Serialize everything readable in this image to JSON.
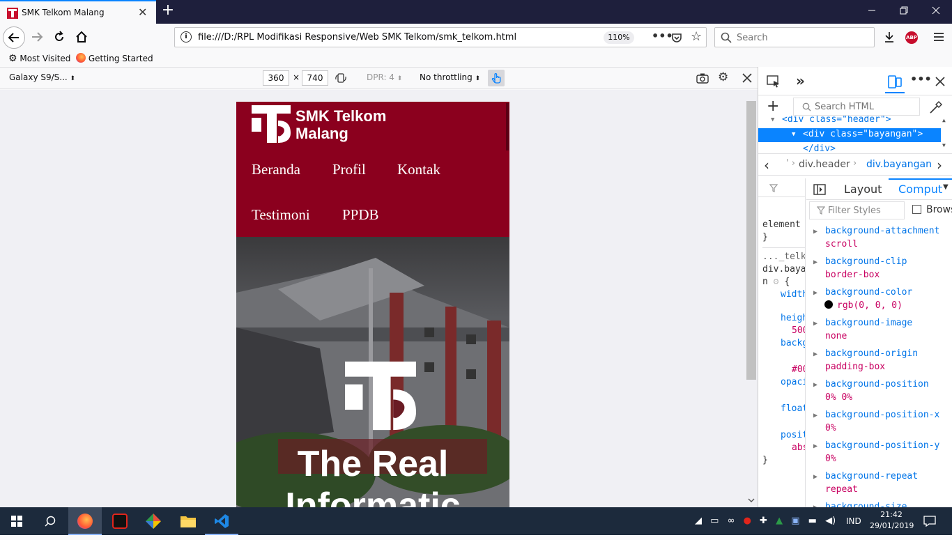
{
  "browser": {
    "tab_title": "SMK Telkom Malang",
    "tab_close": "✕",
    "new_tab": "+",
    "url": "file:///D:/RPL Modifikasi Responsive/Web SMK Telkom/smk_telkom.html",
    "zoom": "110%",
    "search_placeholder": "Search",
    "abp": "ABP",
    "accent": "#0a84ff"
  },
  "bookmarks": {
    "most_visited": "Most Visited",
    "getting_started": "Getting Started"
  },
  "rdm": {
    "device": "Galaxy S9/S...",
    "width": "360",
    "times": "×",
    "height": "740",
    "dpr": "DPR: 4",
    "throttling": "No throttling"
  },
  "site": {
    "brand_line1": "SMK Telkom",
    "brand_line2": "Malang",
    "menu": [
      "Beranda",
      "Profil",
      "Kontak",
      "Testimoni",
      "PPDB"
    ],
    "hero_title_line1": "The Real",
    "hero_title_line2": "Informatic",
    "header_color": "#8b001e"
  },
  "devtools": {
    "search_html": "Search HTML",
    "node_header": "<div class=\"header\">",
    "node_selected": "<div class=\"bayangan\">",
    "node_close": "</div>",
    "crumb_1": "div.header",
    "crumb_2": "div.bayangan",
    "tab_layout": "Layout",
    "tab_computed": "Comput",
    "filter_styles": "Filter Styles",
    "browser_styles": "Brows",
    "rules": {
      "element": "element",
      "brace_close": "}",
      "source": "..._telkom",
      "selector": "div.baya",
      "selector2": "n",
      "brace_open": "{",
      "props": [
        "width",
        "heigh",
        "500",
        "backg",
        "#00",
        "opaci",
        "float",
        "posit",
        "abs"
      ]
    },
    "computed": [
      {
        "name": "background-attachment",
        "value": "scroll"
      },
      {
        "name": "background-clip",
        "value": "border-box"
      },
      {
        "name": "background-color",
        "value": "rgb(0, 0, 0)"
      },
      {
        "name": "background-image",
        "value": "none"
      },
      {
        "name": "background-origin",
        "value": "padding-box"
      },
      {
        "name": "background-position",
        "value": "0% 0%"
      },
      {
        "name": "background-position-x",
        "value": "0%"
      },
      {
        "name": "background-position-y",
        "value": "0%"
      },
      {
        "name": "background-repeat",
        "value": "repeat"
      },
      {
        "name": "background-size",
        "value": ""
      }
    ]
  },
  "taskbar": {
    "lang": "IND",
    "time": "21:42",
    "date": "29/01/2019"
  }
}
